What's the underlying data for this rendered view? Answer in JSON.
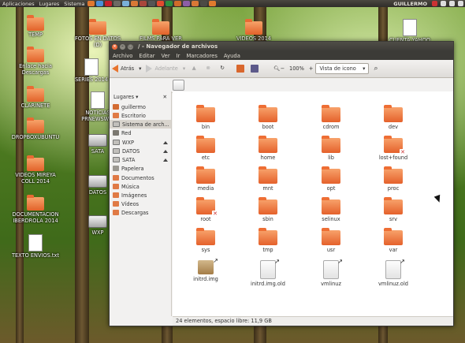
{
  "panel": {
    "menus": [
      "Aplicaciones",
      "Lugares",
      "Sistema"
    ],
    "user": "GUILLERMO"
  },
  "desktop": {
    "left_icons": [
      {
        "label": "TEMP",
        "type": "folder"
      },
      {
        "label": "Enlace hacia Descargas",
        "type": "folder"
      },
      {
        "label": "CLARINETE",
        "type": "folder"
      },
      {
        "label": "DROPBOXUBUNTU",
        "type": "folder"
      },
      {
        "label": "VIDEOS MIREYA COLL 2014",
        "type": "folder"
      },
      {
        "label": "DOCUMENTACION IBERDROLA 2014",
        "type": "folder"
      },
      {
        "label": "TEXTO ENVIOS.txt",
        "type": "document"
      }
    ],
    "middle_icons": [
      {
        "label": "FOTOS EN DATOS (D)",
        "type": "folder"
      },
      {
        "label": "SERIES 2014",
        "type": "folder"
      },
      {
        "label": "NOTICIAS PRNEWSWIR",
        "type": "document"
      },
      {
        "label": "SATA",
        "type": "drive"
      },
      {
        "label": "DATOS",
        "type": "drive"
      },
      {
        "label": "WXP",
        "type": "drive"
      }
    ],
    "top_icons": [
      {
        "label": "FILMS PARA VER EN",
        "type": "folder"
      },
      {
        "label": "VIDEOS 2014",
        "type": "folder"
      },
      {
        "label": "CUENTA YAHOO",
        "type": "document"
      }
    ]
  },
  "window": {
    "title": "/ - Navegador de archivos",
    "menu": [
      "Archivo",
      "Editar",
      "Ver",
      "Ir",
      "Marcadores",
      "Ayuda"
    ],
    "toolbar": {
      "back_label": "Atrás",
      "forward_label": "Adelante",
      "zoom": "100%",
      "view_mode": "Vista de icono"
    },
    "sidebar": {
      "title": "Lugares",
      "items": [
        {
          "label": "guillermo",
          "icon": "home",
          "eject": false,
          "selected": false
        },
        {
          "label": "Escritorio",
          "icon": "folder",
          "eject": false,
          "selected": false
        },
        {
          "label": "Sistema de arch...",
          "icon": "drive",
          "eject": false,
          "selected": true
        },
        {
          "label": "Red",
          "icon": "net",
          "eject": false,
          "selected": false
        },
        {
          "label": "WXP",
          "icon": "drive",
          "eject": true,
          "selected": false
        },
        {
          "label": "DATOS",
          "icon": "drive",
          "eject": true,
          "selected": false
        },
        {
          "label": "SATA",
          "icon": "drive",
          "eject": true,
          "selected": false
        },
        {
          "label": "Papelera",
          "icon": "trash",
          "eject": false,
          "selected": false
        },
        {
          "label": "Documentos",
          "icon": "folder",
          "eject": false,
          "selected": false
        },
        {
          "label": "Música",
          "icon": "folder",
          "eject": false,
          "selected": false
        },
        {
          "label": "Imágenes",
          "icon": "folder",
          "eject": false,
          "selected": false
        },
        {
          "label": "Vídeos",
          "icon": "folder",
          "eject": false,
          "selected": false
        },
        {
          "label": "Descargas",
          "icon": "folder",
          "eject": false,
          "selected": false
        }
      ]
    },
    "files": [
      {
        "name": "bin",
        "type": "folder"
      },
      {
        "name": "boot",
        "type": "folder"
      },
      {
        "name": "cdrom",
        "type": "folder"
      },
      {
        "name": "dev",
        "type": "folder"
      },
      {
        "name": "etc",
        "type": "folder"
      },
      {
        "name": "home",
        "type": "folder"
      },
      {
        "name": "lib",
        "type": "folder"
      },
      {
        "name": "lost+found",
        "type": "folder-locked"
      },
      {
        "name": "media",
        "type": "folder"
      },
      {
        "name": "mnt",
        "type": "folder"
      },
      {
        "name": "opt",
        "type": "folder"
      },
      {
        "name": "proc",
        "type": "folder"
      },
      {
        "name": "root",
        "type": "folder-locked"
      },
      {
        "name": "sbin",
        "type": "folder"
      },
      {
        "name": "selinux",
        "type": "folder"
      },
      {
        "name": "srv",
        "type": "folder"
      },
      {
        "name": "sys",
        "type": "folder"
      },
      {
        "name": "tmp",
        "type": "folder"
      },
      {
        "name": "usr",
        "type": "folder"
      },
      {
        "name": "var",
        "type": "folder"
      },
      {
        "name": "initrd.img",
        "type": "package-link"
      },
      {
        "name": "initrd.img.old",
        "type": "doc-link"
      },
      {
        "name": "vmlinuz",
        "type": "doc-link"
      },
      {
        "name": "vmlinuz.old",
        "type": "doc-link"
      }
    ],
    "status": "24 elementos, espacio libre: 11,9 GB"
  }
}
